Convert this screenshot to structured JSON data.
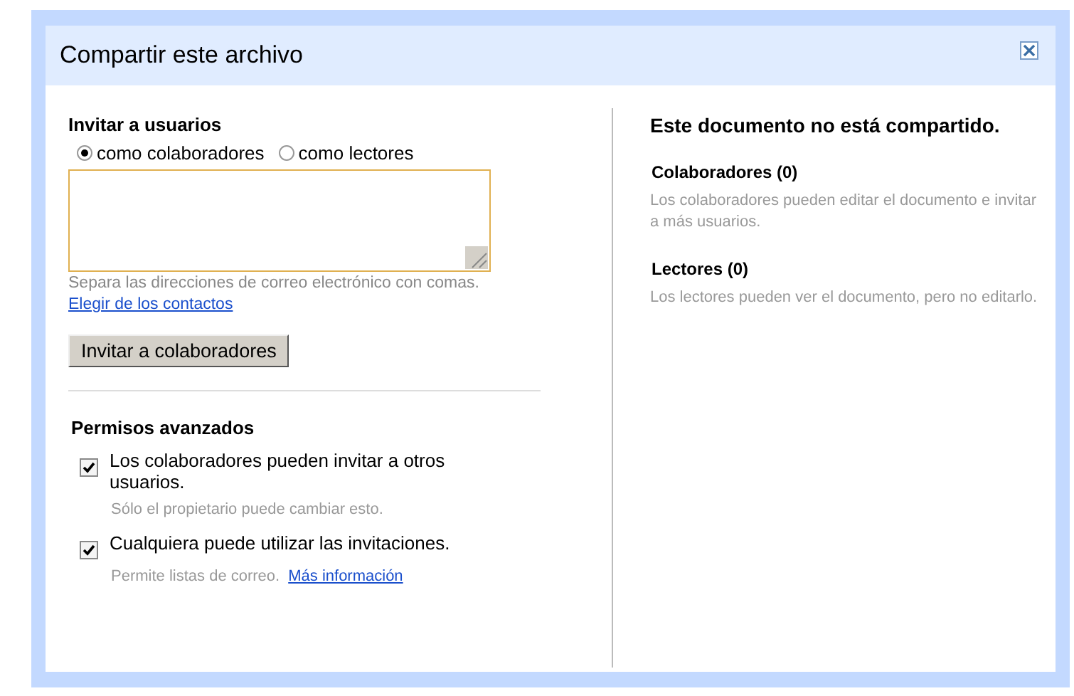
{
  "dialog": {
    "title": "Compartir este archivo"
  },
  "invite": {
    "heading": "Invitar a usuarios",
    "roles": [
      {
        "label": "como colaboradores",
        "selected": true
      },
      {
        "label": "como lectores",
        "selected": false
      }
    ],
    "hint": "Separa las direcciones de correo electrónico con comas.",
    "contacts_link": "Elegir de los contactos",
    "button": "Invitar a colaboradores"
  },
  "advanced": {
    "heading": "Permisos avanzados",
    "options": [
      {
        "label": "Los colaboradores pueden invitar a otros usuarios.",
        "checked": true,
        "note": "Sólo el propietario puede cambiar esto."
      },
      {
        "label": "Cualquiera puede utilizar las invitaciones.",
        "checked": true,
        "note": "Permite listas de correo.",
        "link": "Más información"
      }
    ]
  },
  "status": {
    "heading": "Este documento no está compartido.",
    "groups": [
      {
        "title": "Colaboradores (0)",
        "text": "Los colaboradores pueden editar el documento e invitar a más usuarios."
      },
      {
        "title": "Lectores (0)",
        "text": "Los lectores pueden ver el documento, pero no editarlo."
      }
    ]
  }
}
